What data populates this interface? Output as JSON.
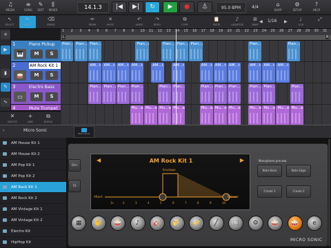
{
  "top_toolbar": {
    "buttons": [
      {
        "icon": "media-icon",
        "glyph": "♫",
        "label": "MEDIA"
      },
      {
        "icon": "song-icon",
        "glyph": "≡",
        "label": "SONG"
      },
      {
        "icon": "edit-icon",
        "glyph": "✎",
        "label": "EDIT"
      },
      {
        "icon": "mixer-icon",
        "glyph": "⫼",
        "label": "MIXER"
      }
    ],
    "position": "14.1.3",
    "bpm": "95.0 BPM",
    "signature": "4/4",
    "right_buttons": [
      {
        "icon": "shop-icon",
        "glyph": "⌂",
        "label": "SHOP"
      },
      {
        "icon": "setup-icon",
        "glyph": "⚙",
        "label": "SETUP"
      },
      {
        "icon": "help-icon",
        "glyph": "?",
        "label": "HELP"
      }
    ]
  },
  "transport": {
    "rewind": "|◀",
    "forward": "▶|",
    "loop": "↻",
    "play": "▶",
    "record": "●",
    "metronome": "⏃"
  },
  "second_toolbar": {
    "tools": [
      {
        "icon": "select-icon",
        "glyph": "↖",
        "label": "SELECT"
      },
      {
        "icon": "split-icon",
        "glyph": "✂",
        "label": "SPLIT"
      },
      {
        "icon": "erase-icon",
        "glyph": "⌫",
        "label": "ERASE"
      },
      {
        "icon": "draw-icon",
        "glyph": "✏",
        "label": "DRAW"
      },
      {
        "icon": "mute-tool-icon",
        "glyph": "✕",
        "label": "MUTE"
      },
      {
        "icon": "undo-icon",
        "glyph": "↶",
        "label": "UNDO"
      },
      {
        "icon": "redo-icon",
        "glyph": "↷",
        "label": "REDO"
      },
      {
        "icon": "copy-icon",
        "glyph": "⧉",
        "label": "COPY"
      },
      {
        "icon": "paste-icon",
        "glyph": "📋",
        "label": "PASTE"
      },
      {
        "icon": "quantize-icon",
        "glyph": "♪",
        "label": "QUANTIZE"
      },
      {
        "icon": "snap-icon",
        "glyph": "⊞",
        "label": "SNAP"
      }
    ],
    "page": "1/16",
    "page_left": "◀",
    "page_right": "▶",
    "page_icon_label": "1/16"
  },
  "ruler": {
    "bars": [
      "1",
      "2",
      "3",
      "4",
      "5",
      "6",
      "7",
      "8",
      "9",
      "10",
      "11",
      "12",
      "13",
      "14",
      "15",
      "16",
      "17",
      "18",
      "19",
      "20",
      "21",
      "22",
      "23",
      "24",
      "25",
      "26",
      "27",
      "28",
      "29",
      "30",
      "31"
    ],
    "left_marker": "L",
    "right_marker": "R"
  },
  "tracks": [
    {
      "number": "1",
      "name": "Piano Pickup",
      "icon_glyph": "🎹",
      "mute": "M",
      "solo": "S",
      "color": "#3a7fc0"
    },
    {
      "number": "2",
      "name": "AM Rock Kit 1",
      "icon_glyph": "🥁",
      "mute": "M",
      "solo": "S",
      "color": "#4a6cd0"
    },
    {
      "number": "3",
      "name": "Electro Bass",
      "icon_glyph": "▭",
      "mute": "M",
      "solo": "S",
      "color": "#8a58c8"
    },
    {
      "number": "4",
      "name": "Mute Trumpet",
      "icon_glyph": "♬",
      "mute": "M",
      "solo": "S",
      "color": "#a058c8"
    }
  ],
  "clips": {
    "track1": [
      "Pian...p",
      "Pian...p",
      "Pian...p",
      "Pian...p",
      "Pian...p",
      "Pian...p",
      "Pian...p",
      "Pian...p",
      "Pian...p"
    ],
    "track2": [
      "AM...t 1",
      "AM...t 1",
      "AM...t 1",
      "AM...t 1",
      "AM...t 1",
      "AM...t 1",
      "AM...t 1",
      "AM...t 1",
      "AM...t 1",
      "AM...t 1",
      "AM...t 1",
      "AM...t 1"
    ],
    "track3": [
      "Pian...p",
      "Pian...p",
      "Pian...p",
      "Pian...p",
      "Pian...p",
      "Pian...p",
      "Pian...p",
      "Pian...p",
      "Pian...p",
      "Pian...p",
      "Pian...p",
      "Pian...p"
    ],
    "track4": [
      "Mu...et",
      "Mu...et",
      "Mu...et",
      "Mu...et",
      "Mu...et",
      "Mu...et",
      "Mu...et",
      "Mu...et",
      "Mu...et",
      "Mu...et",
      "Mu...et"
    ]
  },
  "track_buttons": [
    {
      "icon": "delete-icon",
      "glyph": "✕",
      "label": "DELETE"
    },
    {
      "icon": "add-icon",
      "glyph": "+",
      "label": "ADD"
    },
    {
      "icon": "duplicate-icon",
      "glyph": "⧉",
      "label": "DUPLIC"
    }
  ],
  "instrument": {
    "title": "Micro Sonic",
    "presets": [
      "AM House Kit 1",
      "AM House Kit 2",
      "AM Pop Kit 1",
      "AM Pop Kit 2",
      "AM Rock Kit 1",
      "AM Rock Kit 2",
      "AM Vintage Kit 1",
      "AM Vintage Kit 2",
      "Electro Kit",
      "HipHop Kit"
    ],
    "selected_preset_index": 4,
    "display_title": "AM Rock Kit 1",
    "envelope_label": "Envelope",
    "attack_label": "Attack",
    "release_label": "Release",
    "scale_ticks": [
      "1s",
      "2",
      "3",
      "4",
      "5",
      "6",
      "7",
      "8",
      "9",
      "10"
    ],
    "right_panel_title": "Monophone preview",
    "right_buttons": [
      "Note Bank",
      "Note Edge",
      "Create 1",
      "Create 2"
    ],
    "left_buttons": [
      "Dim",
      "Fit"
    ],
    "brand": "MICRO SONIC",
    "knobs": [
      "▦",
      "✋",
      "🥁",
      "♪",
      "🎸",
      "🎷",
      "🎺",
      "╱",
      "⬚",
      "⚙",
      "🥁",
      "🥁",
      "e"
    ]
  }
}
